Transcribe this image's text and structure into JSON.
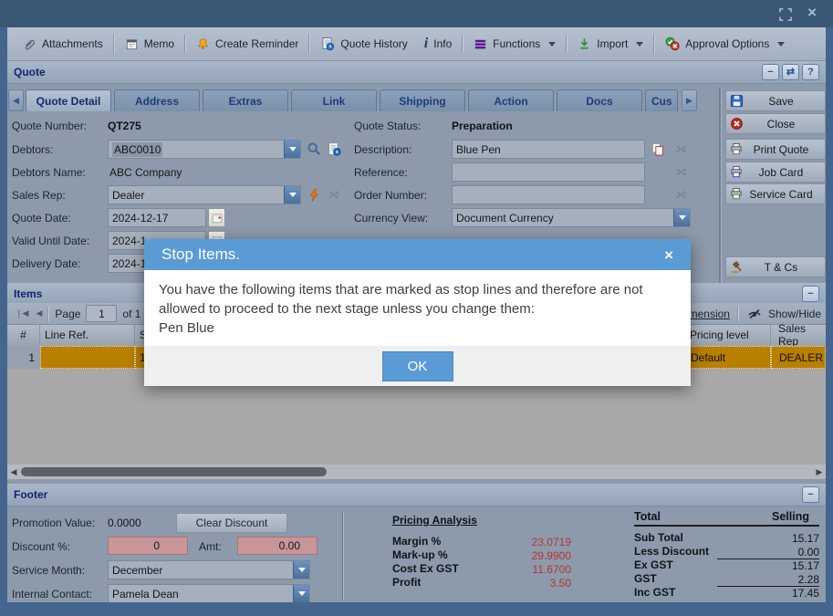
{
  "glyphs": {
    "minimize": "−",
    "refresh": "⇄",
    "help": "?",
    "close_x": "×",
    "prev": "◀",
    "next": "▶",
    "first": "❘◀",
    "info_i": "i"
  },
  "colors": {
    "dialog_accent": "#5b9bd5",
    "stop_row_highlight": "#b87f00",
    "negative_value": "#b43530"
  },
  "toolbar": {
    "items": [
      {
        "label": "Attachments"
      },
      {
        "label": "Memo"
      },
      {
        "label": "Create Reminder"
      },
      {
        "label": "Quote History"
      },
      {
        "label": "Info"
      },
      {
        "label": "Functions"
      },
      {
        "label": "Import"
      },
      {
        "label": "Approval Options"
      }
    ]
  },
  "quote_panel": {
    "title": "Quote"
  },
  "tabs": [
    {
      "label": "Quote Detail"
    },
    {
      "label": "Address"
    },
    {
      "label": "Extras"
    },
    {
      "label": "Link"
    },
    {
      "label": "Shipping"
    },
    {
      "label": "Action"
    },
    {
      "label": "Docs"
    },
    {
      "label": "Cus"
    }
  ],
  "side_buttons": {
    "save": "Save",
    "close": "Close",
    "print_quote": "Print Quote",
    "job_card": "Job Card",
    "service_card": "Service Card",
    "tcs": "T & Cs"
  },
  "form": {
    "quote_number": {
      "label": "Quote Number:",
      "value": "QT275"
    },
    "debtors": {
      "label": "Debtors:",
      "value": "ABC0010"
    },
    "debtors_name": {
      "label": "Debtors Name:",
      "value": "ABC Company"
    },
    "sales_rep": {
      "label": "Sales Rep:",
      "value": "Dealer"
    },
    "quote_date": {
      "label": "Quote Date:",
      "value": "2024-12-17"
    },
    "valid_until": {
      "label": "Valid Until Date:",
      "value": "2024-1"
    },
    "delivery_date": {
      "label": "Delivery Date:",
      "value": "2024-1"
    },
    "quote_status": {
      "label": "Quote Status:",
      "value": "Preparation"
    },
    "description": {
      "label": "Description:",
      "value": "Blue Pen"
    },
    "reference": {
      "label": "Reference:",
      "value": ""
    },
    "order_number": {
      "label": "Order Number:",
      "value": ""
    },
    "currency_view": {
      "label": "Currency View:",
      "value": "Document Currency"
    }
  },
  "items": {
    "title": "Items",
    "pagination": {
      "page_label": "Page",
      "page_value": "1",
      "of_label": "of 1"
    },
    "tools": {
      "dimension": "Dimension",
      "show_hide": "Show/Hide"
    },
    "columns": {
      "num": "#",
      "line_ref": "Line Ref.",
      "partial": "S",
      "pricing_level": "Pricing level",
      "sales_rep": "Sales Rep"
    },
    "row": {
      "num": "1",
      "line_ref": "",
      "partial_value": "1",
      "pricing_level": "Default",
      "sales_rep": "DEALER"
    }
  },
  "footer": {
    "title": "Footer",
    "promotion": {
      "label": "Promotion Value:",
      "value": "0.0000"
    },
    "clear_discount_label": "Clear Discount",
    "discount": {
      "label": "Discount %:",
      "value": "0"
    },
    "amt": {
      "label": "Amt:",
      "value": "0.00"
    },
    "service_month": {
      "label": "Service Month:",
      "value": "December"
    },
    "internal_contact": {
      "label": "Internal Contact:",
      "value": "Pamela Dean"
    },
    "pricing_analysis": {
      "title": "Pricing Analysis",
      "rows": [
        {
          "label": "Margin %",
          "value": "23.0719"
        },
        {
          "label": "Mark-up %",
          "value": "29.9900"
        },
        {
          "label": "Cost Ex GST",
          "value": "11.6700"
        },
        {
          "label": "Profit",
          "value": "3.50"
        }
      ]
    },
    "totals": {
      "title": "Total",
      "column": "Selling",
      "rows": [
        {
          "label": "Sub Total",
          "value": "15.17"
        },
        {
          "label": "Less Discount",
          "value": "0.00"
        },
        {
          "label": "Ex GST",
          "value": "15.17"
        },
        {
          "label": "GST",
          "value": "2.28"
        },
        {
          "label": "Inc GST",
          "value": "17.45"
        }
      ]
    }
  },
  "dialog": {
    "title": "Stop Items.",
    "message": "You have the following items that are marked as stop lines and therefore are not allowed to proceed to the next stage unless you change them:",
    "item": "Pen Blue",
    "ok_label": "OK"
  }
}
